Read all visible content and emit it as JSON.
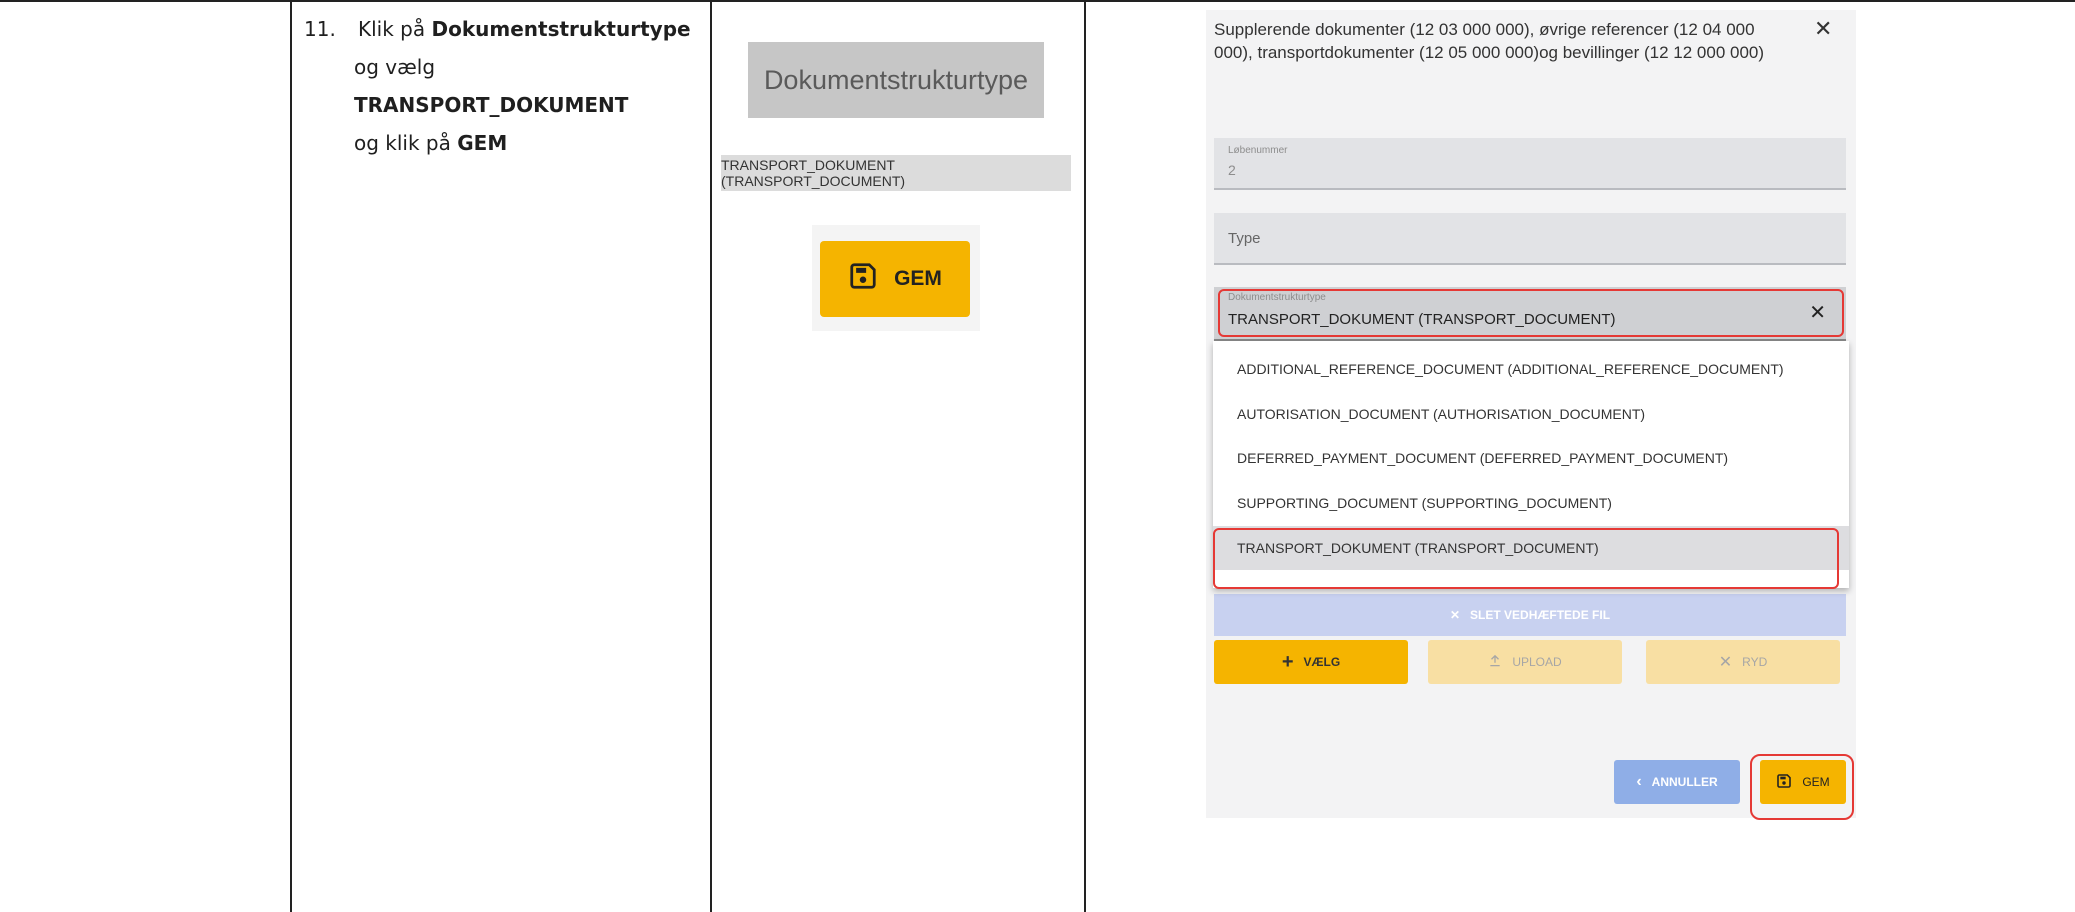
{
  "instructions": {
    "step_number": "11.",
    "line1_pre": "Klik på ",
    "line1_bold": "Dokumentstrukturtype",
    "line2": "og vælg",
    "line3_bold": "TRANSPORT_DOKUMENT",
    "line4_pre": "og klik på ",
    "line4_bold": "GEM"
  },
  "illustration": {
    "field_label": "Dokumentstrukturtype",
    "option_label": "TRANSPORT_DOKUMENT (TRANSPORT_DOCUMENT)",
    "gem_label": "GEM"
  },
  "dialog": {
    "title": "Supplerende dokumenter (12 03 000 000), øvrige referencer (12 04 000 000), transportdokumenter (12 05 000 000)og bevillinger (12 12 000 000)",
    "close_glyph": "✕",
    "lobenummer": {
      "label": "Løbenummer",
      "value": "2"
    },
    "type": {
      "placeholder": "Type"
    },
    "dokumentstrukturtype": {
      "label": "Dokumentstrukturtype",
      "value": "TRANSPORT_DOKUMENT (TRANSPORT_DOCUMENT)",
      "clear_glyph": "✕"
    },
    "options": [
      "ADDITIONAL_REFERENCE_DOCUMENT (ADDITIONAL_REFERENCE_DOCUMENT)",
      "AUTORISATION_DOCUMENT (AUTHORISATION_DOCUMENT)",
      "DEFERRED_PAYMENT_DOCUMENT (DEFERRED_PAYMENT_DOCUMENT)",
      "SUPPORTING_DOCUMENT (SUPPORTING_DOCUMENT)",
      "TRANSPORT_DOKUMENT (TRANSPORT_DOCUMENT)"
    ],
    "selected_option_index": 4,
    "slet_label": "SLET VEDHÆFTEDE FIL",
    "vaelg_label": "VÆLG",
    "upload_label": "UPLOAD",
    "ryd_label": "RYD",
    "annuller_label": "ANNULLER",
    "gem_label": "GEM"
  },
  "colors": {
    "accent": "#f5b400",
    "highlight": "#e53935",
    "secondary_button": "#8faee7"
  }
}
